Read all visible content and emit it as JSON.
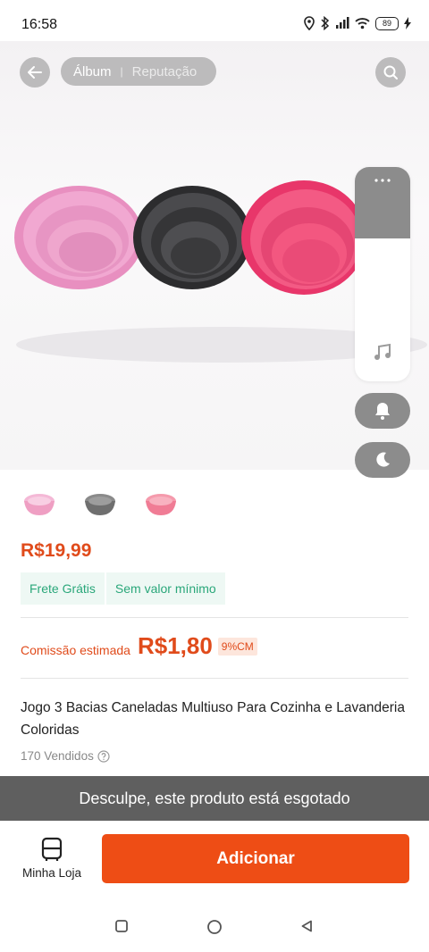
{
  "status_bar": {
    "time": "16:58",
    "battery_level": "89"
  },
  "header": {
    "tabs": [
      {
        "label": "Álbum"
      },
      {
        "label": "Reputação"
      }
    ],
    "icons": {
      "back": "arrow-left-icon",
      "search": "search-icon"
    }
  },
  "side_panel": {
    "icons": [
      "more-dots-icon",
      "music-note-icon",
      "bell-icon",
      "moon-icon"
    ]
  },
  "thumbnails": [
    {
      "color": "#ef9fc3"
    },
    {
      "color": "#7a7a7a"
    },
    {
      "color": "#f07c95"
    }
  ],
  "product": {
    "price": "R$19,99",
    "shipping_tags": [
      "Frete Grátis",
      "Sem valor mínimo"
    ],
    "commission_label": "Comissão estimada",
    "commission_value": "R$1,80",
    "commission_badge": "9%CM",
    "title": "Jogo 3 Bacias Caneladas Multiuso Para Cozinha e Lavanderia Coloridas",
    "sold": "170 Vendidos"
  },
  "banner": {
    "text": "Desculpe, este produto está esgotado"
  },
  "bottom_bar": {
    "store_label": "Minha Loja",
    "add_label": "Adicionar"
  },
  "colors": {
    "accent": "#ee4d15",
    "price": "#e04b1b",
    "shipping": "#2aa77a",
    "banner_bg": "#5f5f5f"
  }
}
